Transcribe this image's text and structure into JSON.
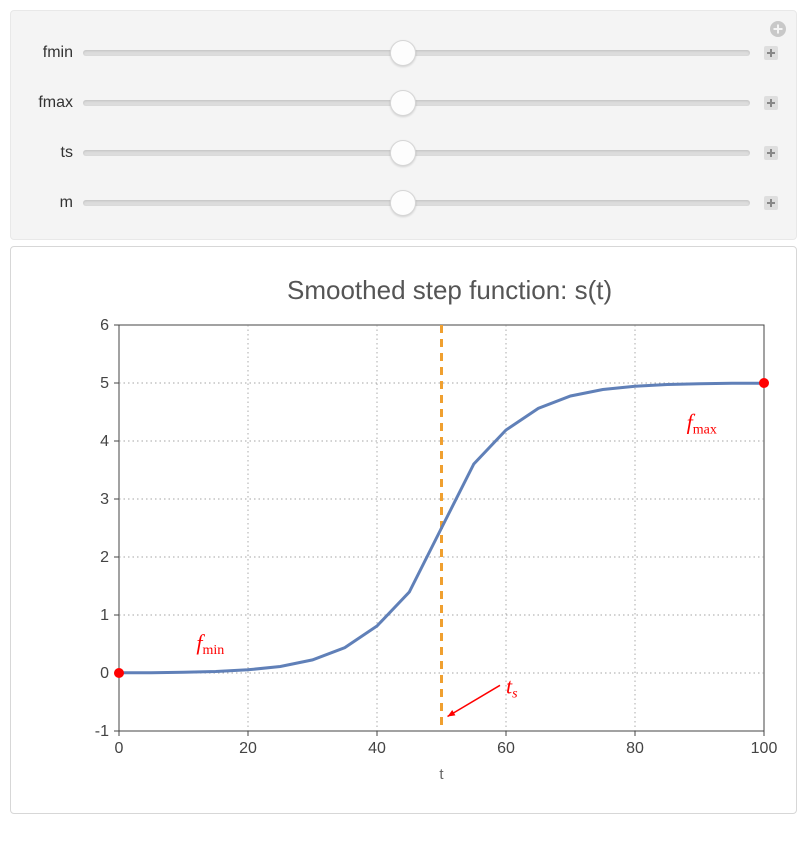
{
  "controls": {
    "sliders": [
      {
        "key": "fmin",
        "label": "fmin",
        "position_pct": 48
      },
      {
        "key": "fmax",
        "label": "fmax",
        "position_pct": 48
      },
      {
        "key": "ts",
        "label": "ts",
        "position_pct": 48
      },
      {
        "key": "m",
        "label": "m",
        "position_pct": 48
      }
    ]
  },
  "chart_data": {
    "type": "line",
    "title": "Smoothed step function: s(t)",
    "xlabel": "t",
    "ylabel": "",
    "xlim": [
      0,
      100
    ],
    "ylim": [
      -1,
      6
    ],
    "xticks": [
      0,
      20,
      40,
      60,
      80,
      100
    ],
    "yticks": [
      -1,
      0,
      1,
      2,
      3,
      4,
      5,
      6
    ],
    "params": {
      "fmin": 0,
      "fmax": 5,
      "ts": 50,
      "m": 0.15
    },
    "vertical_line": {
      "x": 50,
      "label": "t_s",
      "color": "#f0a030",
      "dash": true
    },
    "annotations": [
      {
        "text": "f_min",
        "x": 12,
        "y": 0.4,
        "color": "#ff0000"
      },
      {
        "text": "f_max",
        "x": 88,
        "y": 4.2,
        "color": "#ff0000"
      }
    ],
    "markers": [
      {
        "x": 0,
        "y": 0,
        "color": "#ff0000"
      },
      {
        "x": 100,
        "y": 5,
        "color": "#ff0000"
      }
    ],
    "series": [
      {
        "name": "s(t)",
        "color": "#6080b8",
        "x": [
          0,
          5,
          10,
          15,
          20,
          25,
          30,
          35,
          40,
          45,
          50,
          55,
          60,
          65,
          70,
          75,
          80,
          85,
          90,
          95,
          100
        ],
        "y": [
          0.003,
          0.006,
          0.012,
          0.026,
          0.055,
          0.112,
          0.225,
          0.438,
          0.81,
          1.396,
          2.5,
          3.604,
          4.19,
          4.562,
          4.775,
          4.888,
          4.945,
          4.974,
          4.988,
          4.994,
          4.997
        ]
      }
    ]
  }
}
